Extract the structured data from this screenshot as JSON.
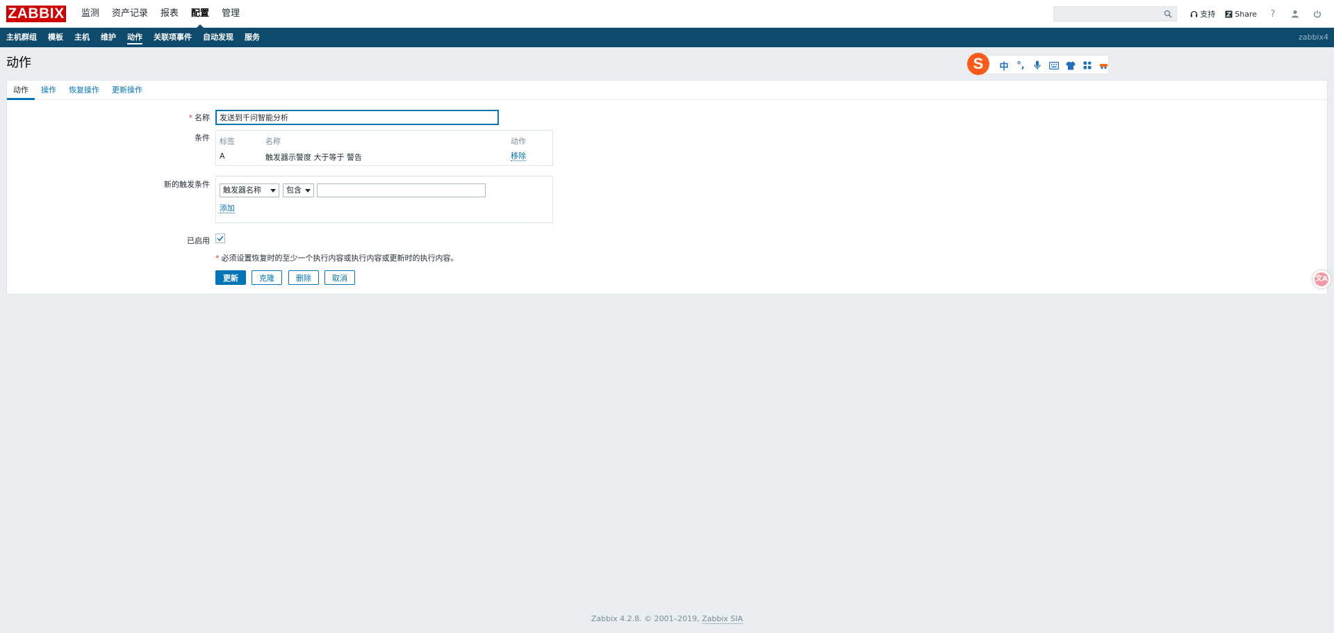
{
  "header": {
    "logo": "ZABBIX",
    "nav": [
      "监测",
      "资产记录",
      "报表",
      "配置",
      "管理"
    ],
    "selected_nav": "配置",
    "search": {
      "value": "",
      "placeholder": ""
    },
    "support_label": "支持",
    "share_label": "Share",
    "help_label": "?"
  },
  "subnav": {
    "items": [
      "主机群组",
      "模板",
      "主机",
      "维护",
      "动作",
      "关联项事件",
      "自动发现",
      "服务"
    ],
    "selected": "动作",
    "server_name": "zabbix4"
  },
  "page": {
    "title": "动作"
  },
  "ime": {
    "logo": "S",
    "items": [
      "中",
      "°,",
      "mic-icon",
      "keyboard-icon",
      "shirt-icon",
      "apps-icon",
      "tools-icon"
    ]
  },
  "tabs": [
    "动作",
    "操作",
    "恢复操作",
    "更新操作"
  ],
  "form": {
    "name_label": "名称",
    "name_value": "发送到千问智能分析",
    "conditions_label": "条件",
    "conditions_table": {
      "headers": [
        "标签",
        "名称",
        "动作"
      ],
      "rows": [
        {
          "label": "A",
          "name": "触发器示警度 大于等于 警告",
          "action": "移除"
        }
      ]
    },
    "new_condition_label": "新的触发条件",
    "new_condition": {
      "type_select": "触发器名称",
      "operator_select": "包含",
      "value": "",
      "add_label": "添加"
    },
    "enabled_label": "已启用",
    "enabled": true,
    "note": "必须设置恢复时的至少一个执行内容或执行内容或更新时的执行内容。",
    "buttons": {
      "update": "更新",
      "clone": "克隆",
      "delete": "删除",
      "cancel": "取消"
    }
  },
  "translate_float": {
    "label": "文A"
  },
  "footer": {
    "text": "Zabbix 4.2.8. © 2001–2019, ",
    "link": "Zabbix SIA"
  },
  "colors": {
    "brand_red": "#d40000",
    "nav_blue": "#0e4a6c",
    "link_blue": "#0275b8",
    "background": "#ebeef0"
  }
}
